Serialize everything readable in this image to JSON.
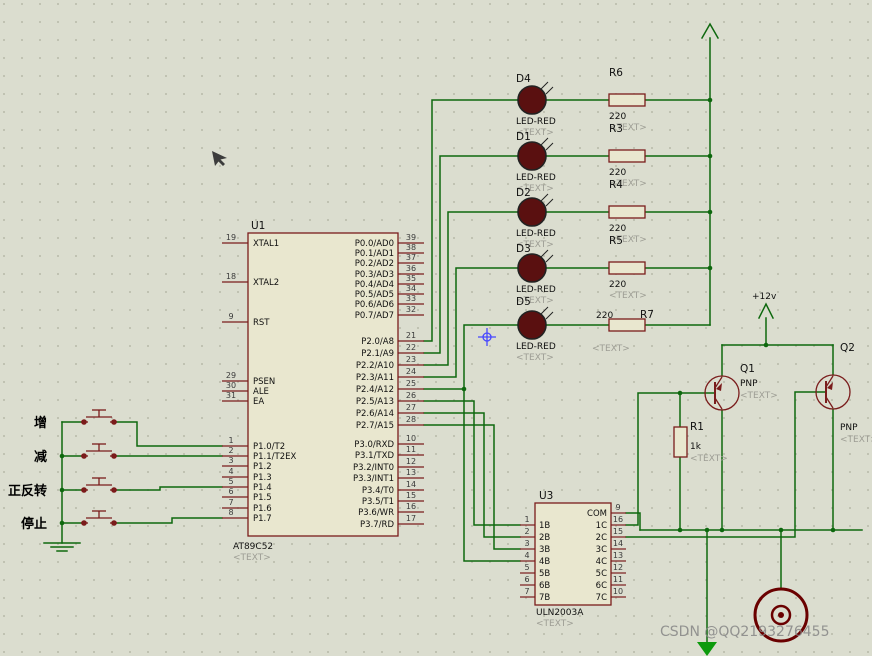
{
  "watermark": "CSDN @QQ2193276455",
  "power": {
    "vcc": "+12v"
  },
  "buttons": [
    {
      "label": "增"
    },
    {
      "label": "减"
    },
    {
      "label": "正反转"
    },
    {
      "label": "停止"
    }
  ],
  "u1": {
    "ref": "U1",
    "value": "AT89C52",
    "text": "<TEXT>",
    "left_pins": [
      {
        "num": "19",
        "name": "XTAL1"
      },
      {
        "num": "18",
        "name": "XTAL2"
      },
      {
        "num": "9",
        "name": "RST"
      },
      {
        "num": "29",
        "name": "PSEN"
      },
      {
        "num": "30",
        "name": "ALE"
      },
      {
        "num": "31",
        "name": "EA"
      },
      {
        "num": "1",
        "name": "P1.0/T2"
      },
      {
        "num": "2",
        "name": "P1.1/T2EX"
      },
      {
        "num": "3",
        "name": "P1.2"
      },
      {
        "num": "4",
        "name": "P1.3"
      },
      {
        "num": "5",
        "name": "P1.4"
      },
      {
        "num": "6",
        "name": "P1.5"
      },
      {
        "num": "7",
        "name": "P1.6"
      },
      {
        "num": "8",
        "name": "P1.7"
      }
    ],
    "right_pins": [
      {
        "num": "39",
        "name": "P0.0/AD0"
      },
      {
        "num": "38",
        "name": "P0.1/AD1"
      },
      {
        "num": "37",
        "name": "P0.2/AD2"
      },
      {
        "num": "36",
        "name": "P0.3/AD3"
      },
      {
        "num": "35",
        "name": "P0.4/AD4"
      },
      {
        "num": "34",
        "name": "P0.5/AD5"
      },
      {
        "num": "33",
        "name": "P0.6/AD6"
      },
      {
        "num": "32",
        "name": "P0.7/AD7"
      },
      {
        "num": "21",
        "name": "P2.0/A8"
      },
      {
        "num": "22",
        "name": "P2.1/A9"
      },
      {
        "num": "23",
        "name": "P2.2/A10"
      },
      {
        "num": "24",
        "name": "P2.3/A11"
      },
      {
        "num": "25",
        "name": "P2.4/A12"
      },
      {
        "num": "26",
        "name": "P2.5/A13"
      },
      {
        "num": "27",
        "name": "P2.6/A14"
      },
      {
        "num": "28",
        "name": "P2.7/A15"
      },
      {
        "num": "10",
        "name": "P3.0/RXD"
      },
      {
        "num": "11",
        "name": "P3.1/TXD"
      },
      {
        "num": "12",
        "name": "P3.2/INT0"
      },
      {
        "num": "13",
        "name": "P3.3/INT1"
      },
      {
        "num": "14",
        "name": "P3.4/T0"
      },
      {
        "num": "15",
        "name": "P3.5/T1"
      },
      {
        "num": "16",
        "name": "P3.6/WR"
      },
      {
        "num": "17",
        "name": "P3.7/RD"
      }
    ]
  },
  "u3": {
    "ref": "U3",
    "value": "ULN2003A",
    "text": "<TEXT>",
    "left_pins": [
      {
        "num": "1",
        "name": "1B"
      },
      {
        "num": "2",
        "name": "2B"
      },
      {
        "num": "3",
        "name": "3B"
      },
      {
        "num": "4",
        "name": "4B"
      },
      {
        "num": "5",
        "name": "5B"
      },
      {
        "num": "6",
        "name": "6B"
      },
      {
        "num": "7",
        "name": "7B"
      }
    ],
    "right_pins": [
      {
        "num": "9",
        "name": "COM"
      },
      {
        "num": "16",
        "name": "1C"
      },
      {
        "num": "15",
        "name": "2C"
      },
      {
        "num": "14",
        "name": "3C"
      },
      {
        "num": "13",
        "name": "4C"
      },
      {
        "num": "12",
        "name": "5C"
      },
      {
        "num": "11",
        "name": "6C"
      },
      {
        "num": "10",
        "name": "7C"
      }
    ]
  },
  "leds": [
    {
      "ref": "D4",
      "value": "LED-RED",
      "text": "<TEXT>"
    },
    {
      "ref": "D1",
      "value": "LED-RED",
      "text": "<TEXT>"
    },
    {
      "ref": "D2",
      "value": "LED-RED",
      "text": "<TEXT>"
    },
    {
      "ref": "D3",
      "value": "LED-RED",
      "text": "<TEXT>"
    },
    {
      "ref": "D5",
      "value": "LED-RED",
      "text": "<TEXT>"
    }
  ],
  "resistors": [
    {
      "ref": "R6",
      "value": "220",
      "text": "<TEXT>"
    },
    {
      "ref": "R3",
      "value": "220",
      "text": "<TEXT>"
    },
    {
      "ref": "R4",
      "value": "220",
      "text": "<TEXT>"
    },
    {
      "ref": "R5",
      "value": "220",
      "text": "<TEXT>"
    },
    {
      "ref": "R7",
      "value": "220",
      "text": "<TEXT>"
    }
  ],
  "r1": {
    "ref": "R1",
    "value": "1k",
    "text": "<TEXT>"
  },
  "q1": {
    "ref": "Q1",
    "value": "PNP",
    "text": "<TEXT>"
  },
  "q2": {
    "ref": "Q2",
    "value": "PNP",
    "text": "<TEXT>"
  },
  "colors": {
    "background": "#dbddcf",
    "grid_dot": "#b8baa8",
    "wire_green": "#0e680e",
    "component_outline": "#7a1c1c",
    "component_fill": "#e9e7cf",
    "led_fill": "#5a1010",
    "terminal_green": "#0c9a0c",
    "crosshair_blue": "#4747ff",
    "watermark_gray": "#868686"
  }
}
